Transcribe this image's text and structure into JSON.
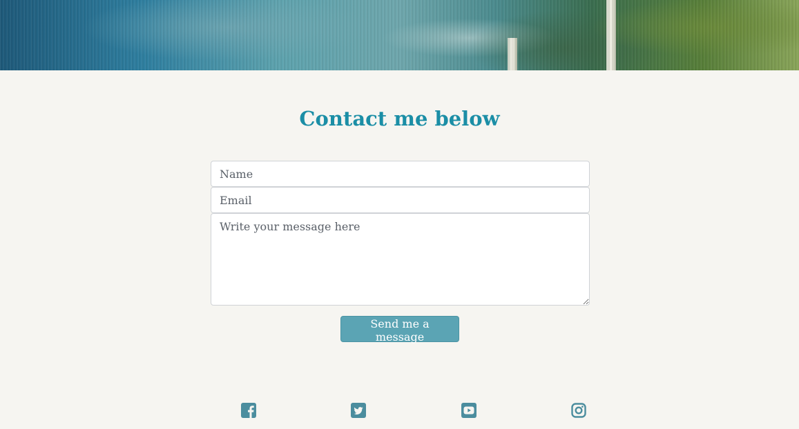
{
  "contact": {
    "heading": "Contact me below",
    "name_placeholder": "Name",
    "email_placeholder": "Email",
    "message_placeholder": "Write your message here",
    "submit_label": "Send me a message"
  },
  "social": {
    "icons": [
      "facebook-icon",
      "twitter-icon",
      "youtube-icon",
      "instagram-icon"
    ]
  },
  "colors": {
    "accent": "#1b8ea6",
    "button": "#5ba4b4",
    "icon": "#4b8d9e",
    "background": "#f6f5f1"
  }
}
